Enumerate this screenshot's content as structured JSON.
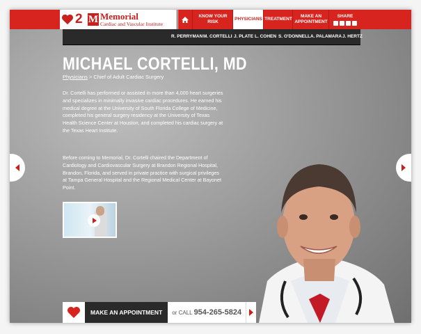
{
  "header": {
    "logo": {
      "numeral": "2",
      "mark": "M",
      "name": "Memorial",
      "subtitle": "Cardiac and Vascular Institute"
    },
    "nav": {
      "home_icon": "home-icon",
      "items": [
        {
          "label": "KNOW YOUR RISK"
        },
        {
          "label": "PHYSICIANS",
          "active": true
        },
        {
          "label": "TREATMENT"
        },
        {
          "label": "MAKE AN APPOINTMENT"
        },
        {
          "label": "SHARE"
        }
      ]
    },
    "share_icons": [
      "facebook-icon",
      "twitter-icon",
      "google-plus-icon",
      "email-icon"
    ]
  },
  "subnav": [
    "R. PERRYMAN",
    "M. CORTELLI",
    "J. PLATE",
    "L. COHEN",
    "S. O'DONNELL",
    "A. PALAMARA",
    "J. HERTZ"
  ],
  "profile": {
    "name": "MICHAEL CORTELLI, MD",
    "breadcrumb_link": "Physicians",
    "breadcrumb_rest": " > Chief of Adult Cardiac Surgery",
    "paragraph1": "Dr. Cortelli has performed or assisted in more than 4,000 heart surgeries and specializes in minimally invasive cardiac procedures. He earned his medical degree at the University of South Florida College of Medicine, completed his general surgery residency at the University of Texas Health Science Center at Houston, and completed his cardiac surgery at the Texas Heart Institute.",
    "paragraph2": "Before coming to Memorial, Dr. Cortelli chaired the Department of Cardiology and Cardiovascular Surgery at Brandon Regional Hospital, Brandon, Florida, and served in private practice with surgical privileges at Tampa General Hospital and the Regional Medical Center at Bayonet Point."
  },
  "bottom_bar": {
    "appointment": "MAKE AN APPOINTMENT",
    "or_call": "or CALL",
    "phone": "954-265-5824"
  },
  "colors": {
    "brand_red": "#d8241f",
    "dark": "#2a2a2a"
  }
}
